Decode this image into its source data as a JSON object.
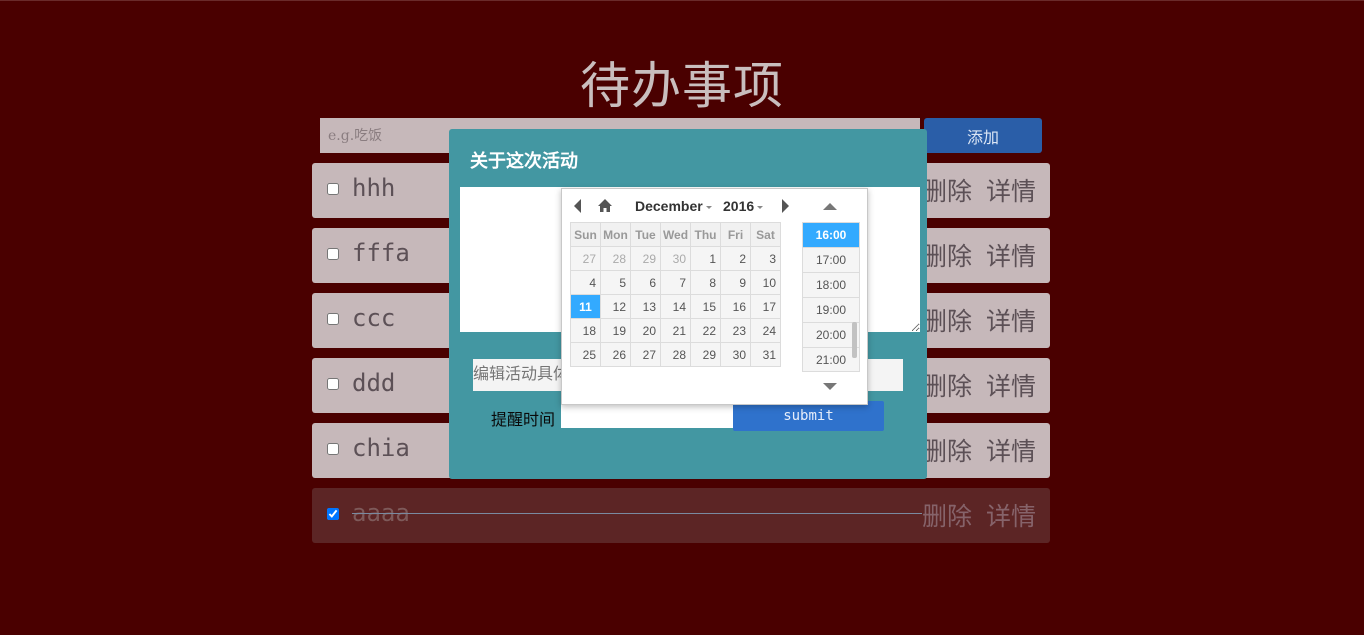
{
  "page": {
    "title": "待办事项"
  },
  "new_todo": {
    "placeholder": "e.g.吃饭",
    "add_label": "添加"
  },
  "todos": [
    {
      "text": "hhh",
      "done": false,
      "delete_label": "删除",
      "detail_label": "详情"
    },
    {
      "text": "fffa",
      "done": false,
      "delete_label": "删除",
      "detail_label": "详情"
    },
    {
      "text": "ccc",
      "done": false,
      "delete_label": "删除",
      "detail_label": "详情"
    },
    {
      "text": "ddd",
      "done": false,
      "delete_label": "删除",
      "detail_label": "详情"
    },
    {
      "text": "chia",
      "done": false,
      "delete_label": "删除",
      "detail_label": "详情"
    },
    {
      "text": "aaaa",
      "done": true,
      "delete_label": "删除",
      "detail_label": "详情"
    }
  ],
  "modal": {
    "title": "关于这次活动",
    "detail_placeholder": "编辑活动具体",
    "reminder_label": "提醒时间",
    "submit_label": "submit"
  },
  "datepicker": {
    "month": "December",
    "year": "2016",
    "weekdays": [
      "Sun",
      "Mon",
      "Tue",
      "Wed",
      "Thu",
      "Fri",
      "Sat"
    ],
    "weeks": [
      [
        "27",
        "28",
        "29",
        "30",
        "1",
        "2",
        "3"
      ],
      [
        "4",
        "5",
        "6",
        "7",
        "8",
        "9",
        "10"
      ],
      [
        "11",
        "12",
        "13",
        "14",
        "15",
        "16",
        "17"
      ],
      [
        "18",
        "19",
        "20",
        "21",
        "22",
        "23",
        "24"
      ],
      [
        "25",
        "26",
        "27",
        "28",
        "29",
        "30",
        "31"
      ]
    ],
    "selected_day": "11",
    "times": [
      "16:00",
      "17:00",
      "18:00",
      "19:00",
      "20:00",
      "21:00"
    ],
    "selected_time": "16:00"
  },
  "colors": {
    "background": "#4a0000",
    "modal": "#4397a2",
    "accent_blue": "#2f72cc",
    "picker_selected": "#33aaff"
  },
  "icons": {
    "prev": "chevron-left-icon",
    "home": "home-icon",
    "next": "chevron-right-icon",
    "up": "chevron-up-icon",
    "down": "chevron-down-icon"
  }
}
